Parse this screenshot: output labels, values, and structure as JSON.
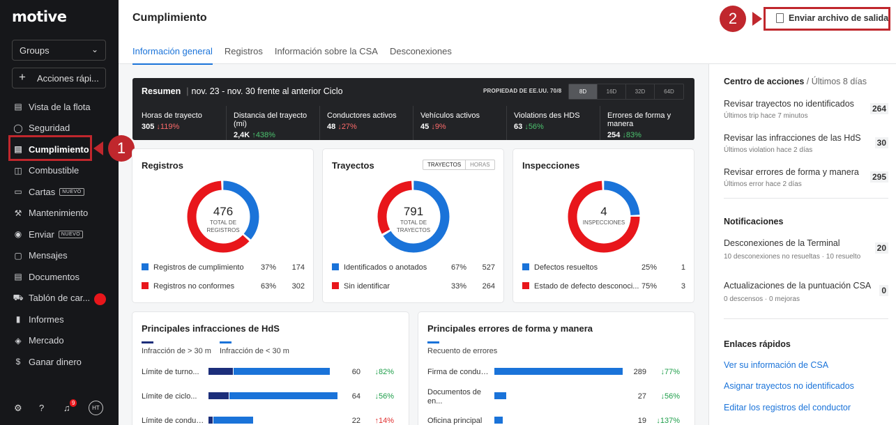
{
  "sidebar": {
    "logo": "motive",
    "groups_label": "Groups",
    "quick_actions_label": "Acciones rápi...",
    "items": [
      {
        "label": "Vista de la flota",
        "icon": "map-icon"
      },
      {
        "label": "Seguridad",
        "icon": "shield-icon"
      },
      {
        "label": "Cumplimiento",
        "icon": "document-icon",
        "active": true
      },
      {
        "label": "Combustible",
        "icon": "fuel-icon"
      },
      {
        "label": "Cartas",
        "icon": "card-icon",
        "badge": "NUEVO"
      },
      {
        "label": "Mantenimiento",
        "icon": "wrench-icon"
      },
      {
        "label": "Enviar",
        "icon": "location-icon",
        "badge": "NUEVO"
      },
      {
        "label": "Mensajes",
        "icon": "chat-icon"
      },
      {
        "label": "Documentos",
        "icon": "documents-icon"
      },
      {
        "label": "Tablón de car...",
        "icon": "truck-icon",
        "dot": true
      },
      {
        "label": "Informes",
        "icon": "reports-icon"
      },
      {
        "label": "Mercado",
        "icon": "layers-icon"
      },
      {
        "label": "Ganar dinero",
        "icon": "dollar-icon"
      }
    ],
    "notif_count": "9",
    "avatar": "HT"
  },
  "annotations": {
    "one": "1",
    "two": "2"
  },
  "header": {
    "title": "Cumplimiento",
    "tabs": [
      "Información general",
      "Registros",
      "Información sobre la CSA",
      "Desconexiones"
    ],
    "send_button": "Enviar archivo de salida"
  },
  "summary": {
    "label": "Resumen",
    "range": "nov. 23 - nov. 30 frente al anterior Ciclo",
    "property": "PROPIEDAD DE EE.UU. 70/8",
    "periods": [
      "8D",
      "16D",
      "32D",
      "64D"
    ],
    "metrics": [
      {
        "label": "Horas de trayecto",
        "value": "305",
        "change": "↓119%",
        "dir": "dn"
      },
      {
        "label": "Distancia del trayecto (mi)",
        "value": "2,4K",
        "change": "↑438%",
        "dir": "up"
      },
      {
        "label": "Conductores activos",
        "value": "48",
        "change": "↓27%",
        "dir": "dn"
      },
      {
        "label": "Vehículos activos",
        "value": "45",
        "change": "↓9%",
        "dir": "dn"
      },
      {
        "label": "Violations des HDS",
        "value": "63",
        "change": "↓56%",
        "dir": "up"
      },
      {
        "label": "Errores de forma y manera",
        "value": "254",
        "change": "↓83%",
        "dir": "up"
      }
    ]
  },
  "cards": {
    "registros": {
      "title": "Registros",
      "total": "476",
      "center_label": "TOTAL DE REGISTROS",
      "fractions": [
        0.37,
        0.63
      ],
      "legend": [
        {
          "label": "Registros de cumplimiento",
          "pct": "37%",
          "count": "174"
        },
        {
          "label": "Registros no conformes",
          "pct": "63%",
          "count": "302"
        }
      ]
    },
    "trayectos": {
      "title": "Trayectos",
      "toggle": [
        "TRAYECTOS",
        "HORAS"
      ],
      "total": "791",
      "center_label": "TOTAL DE TRAYECTOS",
      "fractions": [
        0.67,
        0.33
      ],
      "legend": [
        {
          "label": "Identificados o anotados",
          "pct": "67%",
          "count": "527"
        },
        {
          "label": "Sin identificar",
          "pct": "33%",
          "count": "264"
        }
      ]
    },
    "inspecciones": {
      "title": "Inspecciones",
      "total": "4",
      "center_label": "INSPECCIONES",
      "fractions": [
        0.25,
        0.75
      ],
      "legend": [
        {
          "label": "Defectos resueltos",
          "pct": "25%",
          "count": "1"
        },
        {
          "label": "Estado de defecto desconoci...",
          "pct": "75%",
          "count": "3"
        }
      ]
    }
  },
  "hos": {
    "title": "Principales infracciones de HdS",
    "legend": [
      "Infracción de > 30 m",
      "Infracción de < 30 m"
    ],
    "rows": [
      {
        "label": "Límite de turno...",
        "value": "60",
        "change": "↓82%",
        "dir": "up",
        "dark": 12,
        "light": 48
      },
      {
        "label": "Límite de ciclo...",
        "value": "64",
        "change": "↓56%",
        "dir": "up",
        "dark": 10,
        "light": 54
      },
      {
        "label": "Límite de conduc...",
        "value": "22",
        "change": "↑14%",
        "dir": "dn",
        "dark": 2,
        "light": 20
      }
    ]
  },
  "fm": {
    "title": "Principales errores de forma y manera",
    "legend": [
      "Recuento de errores"
    ],
    "rows": [
      {
        "label": "Firma de conductor",
        "value": "289",
        "change": "↓77%",
        "dir": "up"
      },
      {
        "label": "Documentos de en...",
        "value": "27",
        "change": "↓56%",
        "dir": "up"
      },
      {
        "label": "Oficina principal",
        "value": "19",
        "change": "↓137%",
        "dir": "up"
      }
    ]
  },
  "right": {
    "actions_title": "Centro de acciones",
    "actions_sub": " / Últimos 8 días",
    "actions": [
      {
        "title": "Revisar trayectos no identificados",
        "sub": "Últimos trip hace 7 minutos",
        "count": "264"
      },
      {
        "title": "Revisar las infracciones de las HdS",
        "sub": "Últimos violation hace 2 días",
        "count": "30"
      },
      {
        "title": "Revisar errores de forma y manera",
        "sub": "Últimos error hace 2 días",
        "count": "295"
      }
    ],
    "notif_title": "Notificaciones",
    "notifs": [
      {
        "title": "Desconexiones de la Terminal",
        "sub": "10 desconexiones no resueltas · 10 resuelto",
        "count": "20"
      },
      {
        "title": "Actualizaciones de la puntuación CSA",
        "sub": "0 descensos · 0 mejoras",
        "count": "0"
      }
    ],
    "links_title": "Enlaces rápidos",
    "links": [
      "Ver su información de CSA",
      "Asignar trayectos no identificados",
      "Editar los registros del conductor"
    ]
  },
  "colors": {
    "blue": "#1a73d9",
    "red": "#e8161b",
    "navy": "#1c2e7a",
    "sidebar": "#16171a"
  }
}
